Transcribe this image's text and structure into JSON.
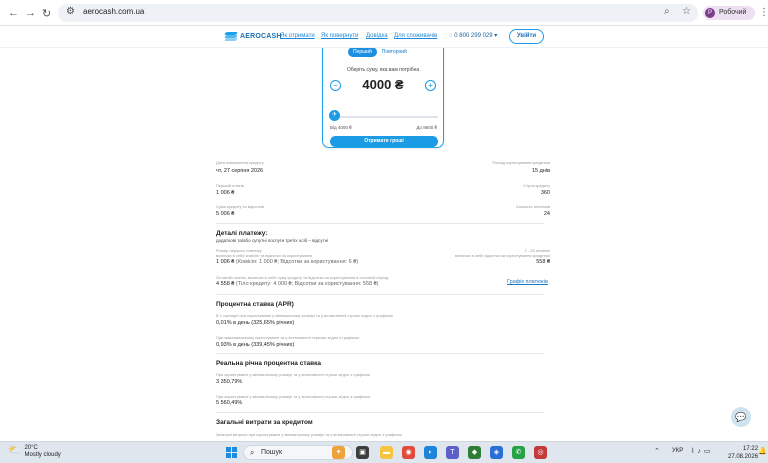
{
  "browser": {
    "url": "aerocash.com.ua",
    "profile_initial": "Р",
    "profile_name": "Робочий"
  },
  "site": {
    "logo_text": "AEROCASH",
    "nav": [
      "Як отримати",
      "Як повернути",
      "Довідка",
      "Для споживачів"
    ],
    "phone": "0 800 299 029",
    "login": "Увійти"
  },
  "calculator": {
    "tab_first": "Перший",
    "tab_repeat": "Повторний",
    "choose_label": "Оберіть суму, яка вам потрібна",
    "amount": "4000 ₴",
    "minus": "−",
    "plus": "+",
    "slider_fraction": 0.0,
    "range_from": "Від 4000 ₴",
    "range_to": "До 8600 ₴",
    "submit": "Отримати гроші"
  },
  "summary": {
    "return_date_label": "Дата повернення кредиту",
    "return_date": "чт, 27 серпня 2026",
    "term_label": "Період користування кредитом",
    "term": "15 днів",
    "first_payment_label": "Перший платіж",
    "first_payment": "1 006 ₴",
    "total_payments_label": "Строк кредиту",
    "total_payments": "360",
    "total_cost_label": "Сума кредиту та відсотків",
    "total_cost": "5 006 ₴",
    "count_label": "Кількість платежів",
    "count": "24"
  },
  "payment_details": {
    "title": "Деталі платежу:",
    "note": "додаткові та/або супутні послуги третіх осіб – відсутні",
    "first_label": "Розмір першого платежу",
    "first_sublabel": "включає в себе комісію та відсотки за користування",
    "first_value": "1 006 ₴",
    "first_detail": "(Комісія: 1 000 ₴; Відсотки за користування: 6 ₴)",
    "mid_label": "2 - 24 платежі",
    "mid_sublabel": "включає в себе відсотки за користування кредитом",
    "mid_value": "558 ₴",
    "last_label": "Останній платіж, включає в себе суму кредиту та відсотки за користування в останній період",
    "last_value": "4 558 ₴",
    "last_detail": "(Тіло кредиту: 4 000 ₴; Відсотки за користування: 558 ₴)",
    "schedule_link": "Графік платежів"
  },
  "apr": {
    "title": "Процентна ставка (APR)",
    "row1_label": "В 1 сценарії при користуванні у мінімальному розмірі та у встановлені строки згідно з графіком",
    "row1_value": "0,01% в день (325,65% річних)",
    "row2_label": "При максимальному користуванні та у встановлені терміни згідно з графіком",
    "row2_value": "0,93% в день (339,45% річних)"
  },
  "real_rate": {
    "title": "Реальна річна процентна ставка",
    "row1_label": "При користуванні у мінімальному розмірі та у встановлені строки згідно з графіком",
    "row1_value": "3 350,79%",
    "row2_label": "При користуванні у мінімальному розмірі та у встановлені строки згідно з графіком",
    "row2_value": "5 560,49%"
  },
  "total_costs": {
    "title": "Загальні витрати за кредитом",
    "row1_label": "Загальні витрати при користуванні у мінімальному розмірі та у встановлені строки згідно з графіком"
  },
  "taskbar": {
    "temp": "20°C",
    "weather": "Mostly cloudy",
    "search": "Пошук",
    "lang": "УКР",
    "time": "17:22",
    "date": "27.08.2026"
  }
}
